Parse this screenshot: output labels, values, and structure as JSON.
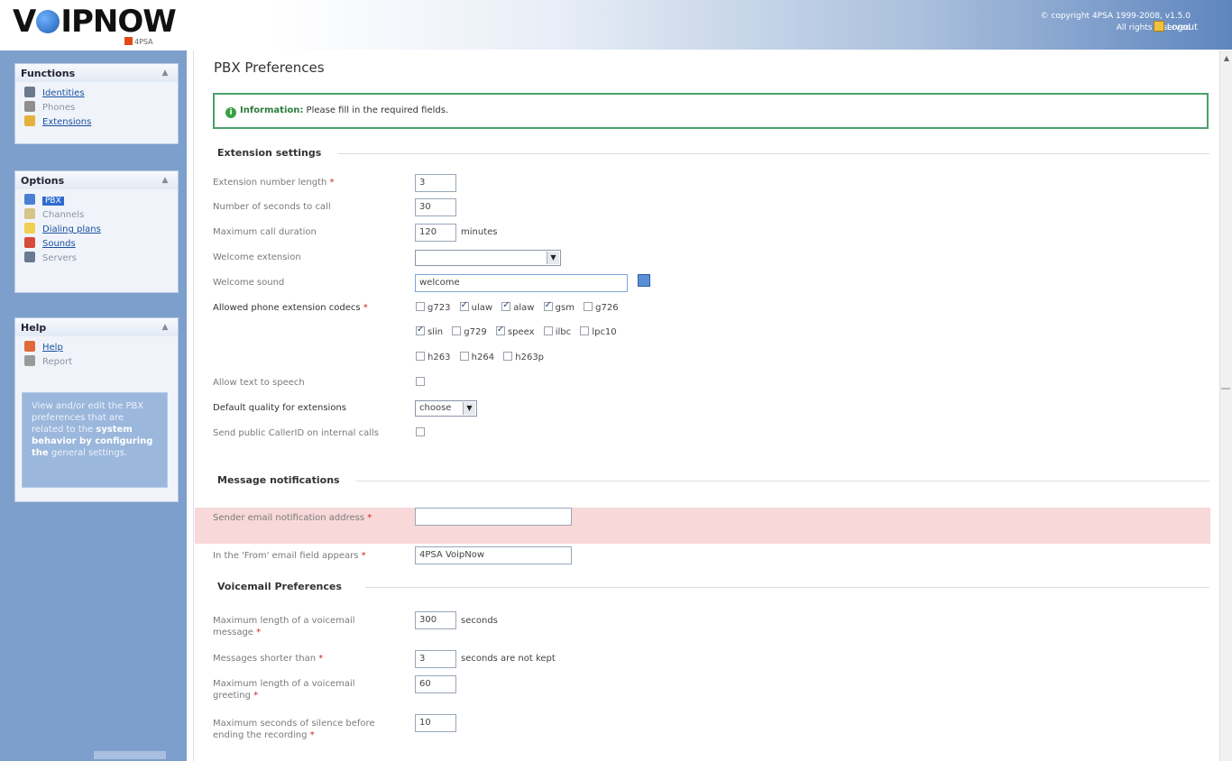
{
  "header": {
    "logo_text": "VOIPNOW",
    "logo_sub": "4PSA",
    "copyright": "© copyright 4PSA 1999-2008, v1.5.0",
    "rights": "All rights reserved",
    "logout": "Logout"
  },
  "sidebar": {
    "functions": {
      "title": "Functions",
      "items": [
        {
          "label": "Identities"
        },
        {
          "label": "Phones"
        },
        {
          "label": "Extensions"
        }
      ]
    },
    "options": {
      "title": "Options",
      "items": [
        {
          "label": "PBX"
        },
        {
          "label": "Channels"
        },
        {
          "label": "Dialing plans"
        },
        {
          "label": "Sounds"
        },
        {
          "label": "Servers"
        }
      ]
    },
    "help": {
      "title": "Help",
      "items": [
        {
          "label": "Help"
        },
        {
          "label": "Report"
        }
      ],
      "box_text_1": "View and/or edit the PBX preferences that are related to the",
      "box_text_2": "system behavior by configuring the",
      "box_text_3": "general settings."
    }
  },
  "main": {
    "title": "PBX Preferences",
    "info_label": "Information:",
    "info_text": "Please fill in the required fields.",
    "sections": {
      "extension": "Extension settings",
      "notifications": "Message notifications",
      "voicemail": "Voicemail Preferences"
    },
    "fields": {
      "ext_length": {
        "label": "Extension number length",
        "value": "3"
      },
      "seconds_to_call": {
        "label": "Number of seconds to call",
        "value": "30"
      },
      "max_call_duration": {
        "label": "Maximum call duration",
        "value": "120",
        "unit": "minutes"
      },
      "welcome_extension": {
        "label": "Welcome extension",
        "value": ""
      },
      "welcome_sound": {
        "label": "Welcome sound",
        "value": "welcome"
      },
      "allowed_codecs": {
        "label": "Allowed phone extension codecs",
        "codecs": [
          {
            "name": "g723",
            "checked": false
          },
          {
            "name": "ulaw",
            "checked": true
          },
          {
            "name": "alaw",
            "checked": true
          },
          {
            "name": "gsm",
            "checked": true
          },
          {
            "name": "g726",
            "checked": false
          },
          {
            "name": "slin",
            "checked": true
          },
          {
            "name": "g729",
            "checked": false
          },
          {
            "name": "speex",
            "checked": true
          },
          {
            "name": "ilbc",
            "checked": false
          },
          {
            "name": "lpc10",
            "checked": false
          },
          {
            "name": "h263",
            "checked": false
          },
          {
            "name": "h264",
            "checked": false
          },
          {
            "name": "h263p",
            "checked": false
          }
        ]
      },
      "text_to_speech": {
        "label": "Allow text to speech"
      },
      "default_quality": {
        "label": "Default quality for extensions",
        "value": "choose"
      },
      "send_public_callerid": {
        "label": "Send public CallerID on internal calls"
      },
      "sender_email": {
        "label": "Sender email notification address",
        "value": ""
      },
      "from_field": {
        "label": "In the 'From' email field appears",
        "value": "4PSA VoipNow"
      },
      "max_message_length": {
        "label": "Maximum length of a voicemail message",
        "value": "300",
        "unit": "seconds"
      },
      "messages_shorter": {
        "label": "Messages shorter than",
        "value": "3",
        "unit": "seconds are not kept"
      },
      "max_greeting": {
        "label": "Maximum length of a voicemail greeting",
        "value": "60"
      },
      "max_silence": {
        "label": "Maximum seconds of silence before ending the recording",
        "value": "10"
      }
    }
  }
}
